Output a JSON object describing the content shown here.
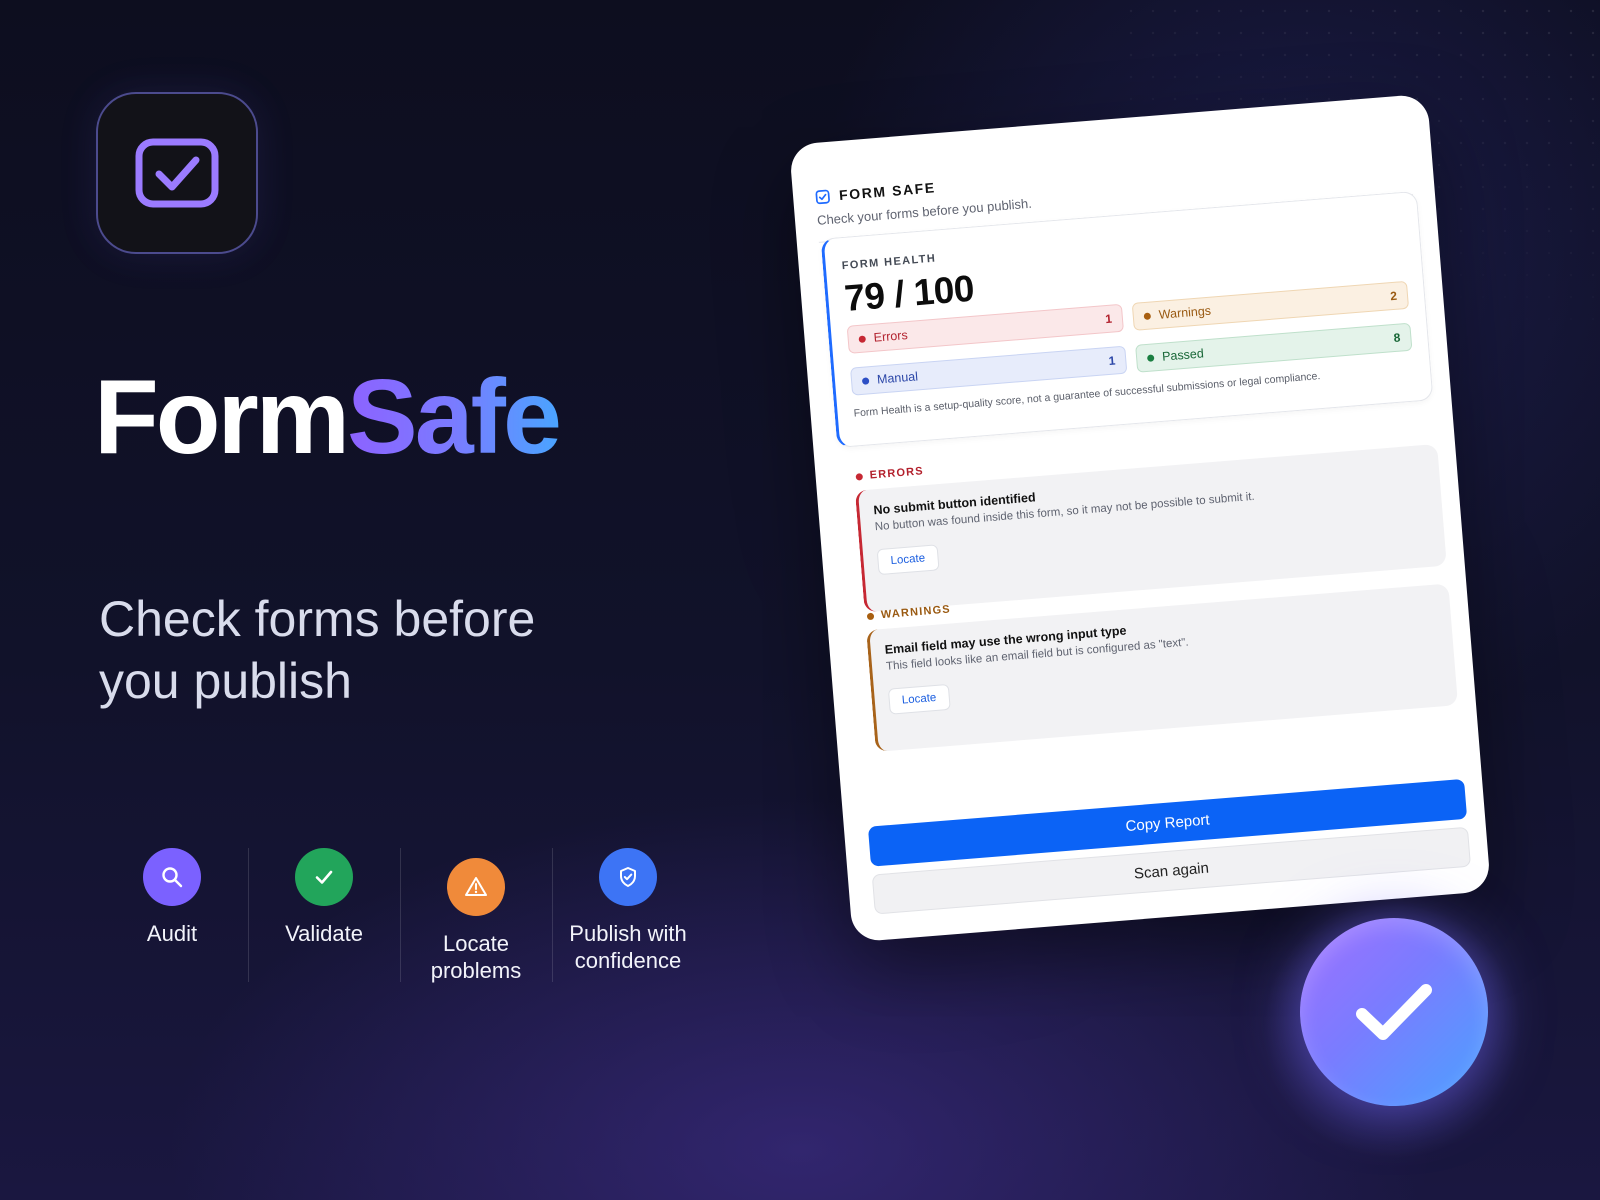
{
  "brand": {
    "name_part1": "Form",
    "name_part2": "Safe"
  },
  "tagline": "Check forms before you publish",
  "features": [
    {
      "label": "Audit",
      "icon": "search-icon",
      "color": "#7b61ff"
    },
    {
      "label": "Validate",
      "icon": "check-icon",
      "color": "#22a55b"
    },
    {
      "label": "Locate problems",
      "icon": "warning-icon",
      "color": "#f08a3a"
    },
    {
      "label": "Publish with confidence",
      "icon": "shield-check-icon",
      "color": "#3d74f5"
    }
  ],
  "card": {
    "title": "FORM SAFE",
    "subtitle": "Check your forms before you publish.",
    "health": {
      "label": "FORM HEALTH",
      "score": "79 / 100",
      "stats": {
        "errors": {
          "label": "Errors",
          "count": "1"
        },
        "warnings": {
          "label": "Warnings",
          "count": "2"
        },
        "manual": {
          "label": "Manual",
          "count": "1"
        },
        "passed": {
          "label": "Passed",
          "count": "8"
        }
      },
      "note": "Form Health is a setup-quality score, not a guarantee of successful submissions or legal compliance."
    },
    "errors_section": {
      "label": "ERRORS",
      "issue": {
        "title": "No submit button identified",
        "description": "No button was found inside this form, so it may not be possible to submit it.",
        "action": "Locate"
      }
    },
    "warnings_section": {
      "label": "WARNINGS",
      "issue": {
        "title": "Email field may use the wrong input type",
        "description": "This field looks like an email field but is configured as \"text\".",
        "action": "Locate"
      }
    },
    "copy_button": "Copy Report",
    "scan_button": "Scan again"
  },
  "colors": {
    "accent_blue": "#0b63f6",
    "brand_gradient_start": "#8d62ff",
    "brand_gradient_end": "#4aa4ff",
    "error": "#c62833",
    "warning": "#a85f10",
    "manual": "#2d4fc5",
    "passed": "#1a7f41"
  }
}
